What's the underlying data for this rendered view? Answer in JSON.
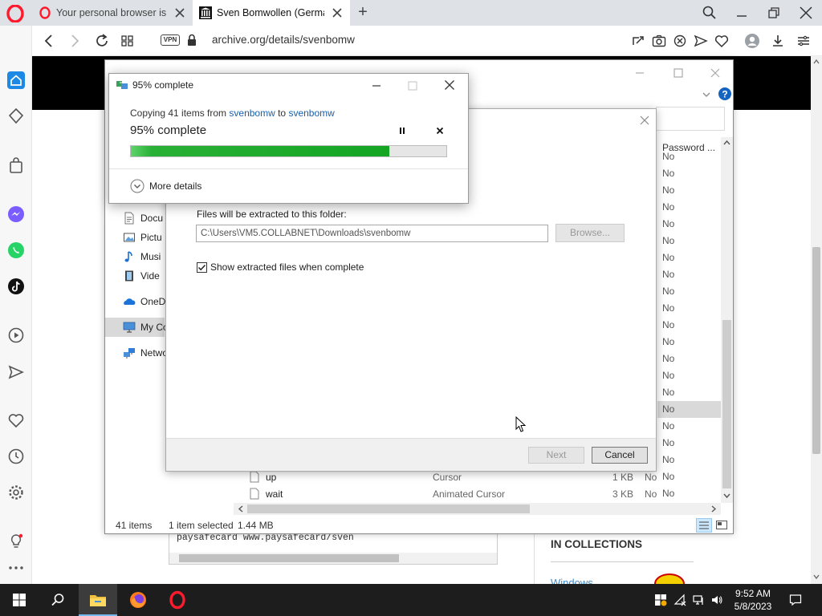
{
  "browser": {
    "tabs": [
      {
        "title": "Your personal browser is a",
        "active": false
      },
      {
        "title": "Sven Bomwollen (German",
        "active": true
      }
    ],
    "new_tab_symbol": "+",
    "vpn_label": "VPN",
    "url": "archive.org/details/svenbomw"
  },
  "page": {
    "text_snippet": "paysafecard www.paysafecard/sven",
    "collections_heading": "IN COLLECTIONS",
    "collections_link": "Windows"
  },
  "explorer": {
    "nav_items": [
      "Docu",
      "Pictu",
      "Musi",
      "Vide",
      "OneD",
      "My Co",
      "Netwo"
    ],
    "nav_icons": [
      "document-icon",
      "pictures-icon",
      "music-icon",
      "videos-icon",
      "onedrive-icon",
      "computer-icon",
      "network-icon"
    ],
    "column_header": "Password ...",
    "password_values": [
      "No",
      "No",
      "No",
      "No",
      "No",
      "No",
      "No",
      "No",
      "No",
      "No",
      "No",
      "No",
      "No",
      "No",
      "No",
      "No",
      "No",
      "No",
      "No",
      "No",
      "No",
      "No"
    ],
    "files": [
      {
        "name": "up",
        "type": "Cursor",
        "size": "1 KB",
        "password": "No"
      },
      {
        "name": "wait",
        "type": "Animated Cursor",
        "size": "3 KB",
        "password": "No"
      }
    ],
    "status": {
      "item_count": "41 items",
      "selection": "1 item selected",
      "size": "1.44 MB"
    }
  },
  "extract_dialog": {
    "folder_label": "Files will be extracted to this folder:",
    "folder_path": "C:\\Users\\VM5.COLLABNET\\Downloads\\svenbomw",
    "browse_label": "Browse...",
    "show_files_label": "Show extracted files when complete",
    "show_files_checked": true,
    "next_label": "Next",
    "cancel_label": "Cancel"
  },
  "copy_dialog": {
    "title": "95% complete",
    "copy_prefix": "Copying 41 items from",
    "source": "svenbomw",
    "to_word": "to",
    "destination": "svenbomw",
    "percent_text": "95% complete",
    "progress_percent": 82,
    "more_details": "More details"
  },
  "taskbar": {
    "time": "9:52 AM",
    "date": "5/8/2023"
  },
  "colors": {
    "progress_green": "#14a523",
    "selection_blue": "#cce8ff",
    "link_blue": "#1a5fa8",
    "taskbar": "#1d1d1d",
    "opera_red": "#ff1b2d"
  }
}
